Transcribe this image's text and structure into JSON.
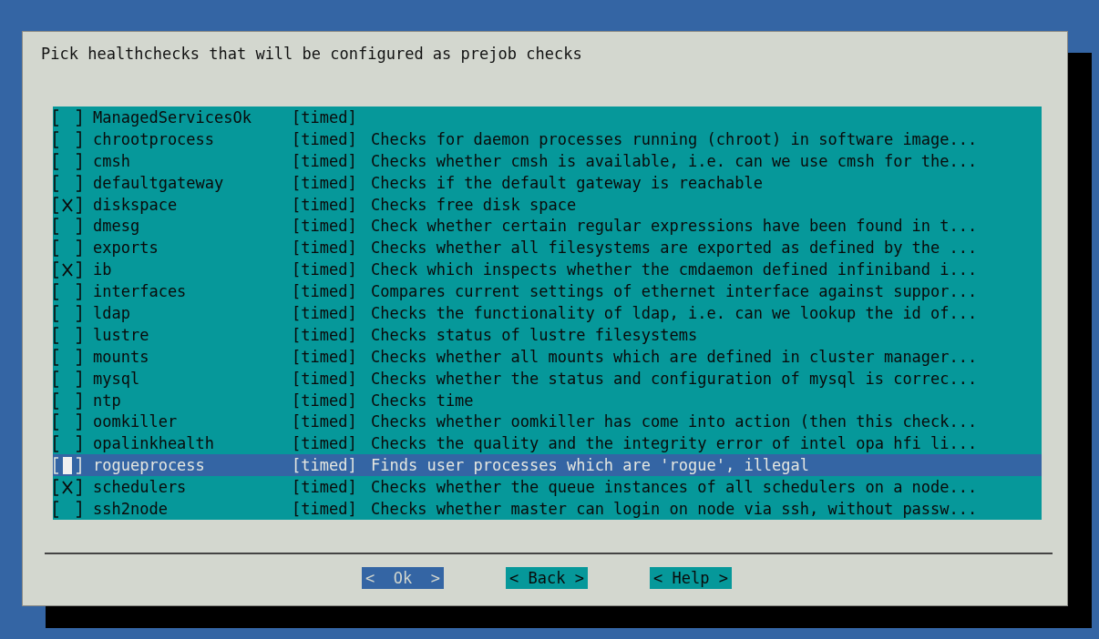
{
  "dialog": {
    "prompt": "Pick healthchecks that will be configured as prejob checks",
    "items": [
      {
        "name": "ManagedServicesOk",
        "tag": "[timed]",
        "checked": false,
        "selected": false
      },
      {
        "name": "chrootprocess",
        "tag": "[timed]",
        "description": "Checks for daemon processes running (chroot) in software image...",
        "checked": false,
        "selected": false
      },
      {
        "name": "cmsh",
        "tag": "[timed]",
        "description": "Checks whether cmsh is available, i.e. can we use cmsh for the...",
        "checked": false,
        "selected": false
      },
      {
        "name": "defaultgateway",
        "tag": "[timed]",
        "description": "Checks if the default gateway is reachable",
        "checked": false,
        "selected": false
      },
      {
        "name": "diskspace",
        "tag": "[timed]",
        "description": "Checks free disk space",
        "checked": true,
        "selected": false
      },
      {
        "name": "dmesg",
        "tag": "[timed]",
        "description": "Check whether certain regular expressions have been found in t...",
        "checked": false,
        "selected": false
      },
      {
        "name": "exports",
        "tag": "[timed]",
        "description": "Checks whether all filesystems are exported as defined by the ...",
        "checked": false,
        "selected": false
      },
      {
        "name": "ib",
        "tag": "[timed]",
        "description": "Check which inspects whether the cmdaemon defined infiniband i...",
        "checked": true,
        "selected": false
      },
      {
        "name": "interfaces",
        "tag": "[timed]",
        "description": "Compares current settings of ethernet interface against suppor...",
        "checked": false,
        "selected": false
      },
      {
        "name": "ldap",
        "tag": "[timed]",
        "description": "Checks the functionality of ldap, i.e. can we lookup the id of...",
        "checked": false,
        "selected": false
      },
      {
        "name": "lustre",
        "tag": "[timed]",
        "description": "Checks status of lustre filesystems",
        "checked": false,
        "selected": false
      },
      {
        "name": "mounts",
        "tag": "[timed]",
        "description": "Checks whether all mounts which are defined in cluster manager...",
        "checked": false,
        "selected": false
      },
      {
        "name": "mysql",
        "tag": "[timed]",
        "description": "Checks whether the status and configuration of mysql is correc...",
        "checked": false,
        "selected": false
      },
      {
        "name": "ntp",
        "tag": "[timed]",
        "description": "Checks time",
        "checked": false,
        "selected": false
      },
      {
        "name": "oomkiller",
        "tag": "[timed]",
        "description": "Checks whether oomkiller has come into action (then this check...",
        "checked": false,
        "selected": false
      },
      {
        "name": "opalinkhealth",
        "tag": "[timed]",
        "description": "Checks the quality and the integrity error of intel opa hfi li...",
        "checked": false,
        "selected": false
      },
      {
        "name": "rogueprocess",
        "tag": "[timed]",
        "description": "Finds user processes which are 'rogue', illegal",
        "checked": false,
        "selected": true
      },
      {
        "name": "schedulers",
        "tag": "[timed]",
        "description": "Checks whether the queue instances of all schedulers on a node...",
        "checked": true,
        "selected": false
      },
      {
        "name": "ssh2node",
        "tag": "[timed]",
        "description": "Checks whether master can login on node via ssh, without passw...",
        "checked": false,
        "selected": false
      }
    ],
    "buttons": [
      {
        "label": "<  Ok  >",
        "selected": true
      },
      {
        "label": "< Back >",
        "selected": false
      },
      {
        "label": "< Help >",
        "selected": false
      }
    ]
  }
}
